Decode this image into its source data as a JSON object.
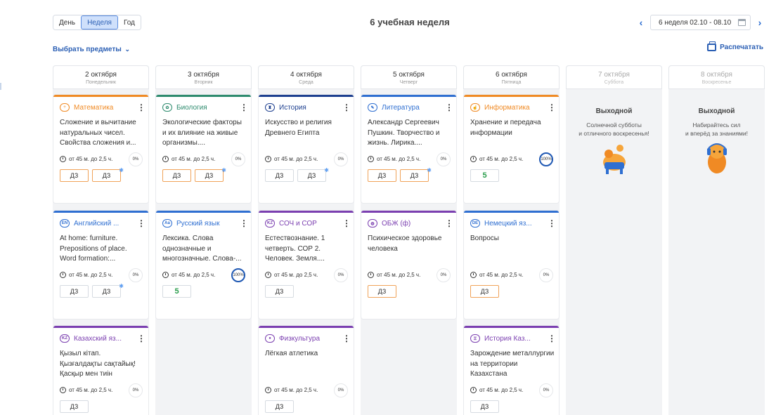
{
  "toolbar": {
    "views": [
      "День",
      "Неделя",
      "Год"
    ],
    "active_view": "Неделя",
    "title": "6 учебная неделя",
    "week_range": "6 неделя 02.10 - 08.10",
    "select_subjects": "Выбрать предметы",
    "print": "Распечатать"
  },
  "card_defaults": {
    "duration": "от 45 м. до 2,5 ч.",
    "hw_label": "ДЗ"
  },
  "days": [
    {
      "date": "2 октября",
      "weekday": "Понедельник",
      "lessons": [
        {
          "subject": "Математика",
          "color": "#f08a24",
          "icon": "math-icon",
          "topic": "Сложение и вычитание натуральных чисел. Свойства сложения и...",
          "progress": "0%",
          "hw": [
            {
              "orange": true,
              "dot": false
            },
            {
              "orange": true,
              "dot": true
            }
          ]
        },
        {
          "subject": "Английский ...",
          "color": "#2f6fd1",
          "icon": "eng-icon",
          "topic": "At home: furniture. Prepositions of place. Word formation:...",
          "progress": "0%",
          "hw": [
            {
              "orange": false,
              "dot": false
            },
            {
              "orange": false,
              "dot": true
            }
          ]
        },
        {
          "subject": "Казахский яз...",
          "color": "#7b3fb0",
          "icon": "kz-icon",
          "topic": "Қызыл кітап. Қызғалдақты сақтайық! Қасқыр мен тиін",
          "progress": "0%",
          "hw": [
            {
              "orange": false,
              "dot": false
            }
          ]
        }
      ]
    },
    {
      "date": "3 октября",
      "weekday": "Вторник",
      "lessons": [
        {
          "subject": "Биология",
          "color": "#2e8b6e",
          "icon": "biology-icon",
          "topic": "Экологические факторы и их влияние на живые организмы....",
          "progress": "0%",
          "hw": [
            {
              "orange": true,
              "dot": false
            },
            {
              "orange": true,
              "dot": true
            }
          ]
        },
        {
          "subject": "Русский язык",
          "color": "#2f6fd1",
          "icon": "russian-icon",
          "topic": "Лексика. Слова однозначные и многозначные. Слова-...",
          "progress": "100%",
          "grade": "5"
        }
      ]
    },
    {
      "date": "4 октября",
      "weekday": "Среда",
      "lessons": [
        {
          "subject": "История",
          "color": "#1d3f8f",
          "icon": "history-icon",
          "topic": "Искусство и религия Древнего Египта",
          "progress": "0%",
          "hw": [
            {
              "orange": false,
              "dot": false
            },
            {
              "orange": false,
              "dot": true
            }
          ]
        },
        {
          "subject": "СОЧ и СОР",
          "color": "#7b3fb0",
          "icon": "kz-icon",
          "topic": "Естествознание. 1 четверть. СОР 2. Человек. Земля....",
          "progress": "0%",
          "hw": [
            {
              "orange": false,
              "dot": false
            }
          ]
        },
        {
          "subject": "Физкультура",
          "color": "#7b3fb0",
          "icon": "ball-icon",
          "topic": "Лёгкая атлетика",
          "progress": "0%",
          "hw": [
            {
              "orange": false,
              "dot": false
            }
          ]
        }
      ]
    },
    {
      "date": "5 октября",
      "weekday": "Четверг",
      "lessons": [
        {
          "subject": "Литература",
          "color": "#2f6fd1",
          "icon": "literature-icon",
          "topic": "Александр Сергеевич Пушкин. Творчество и жизнь. Лирика....",
          "progress": "0%",
          "hw": [
            {
              "orange": true,
              "dot": false
            },
            {
              "orange": true,
              "dot": true
            }
          ]
        },
        {
          "subject": "ОБЖ (ф)",
          "color": "#7b3fb0",
          "icon": "safety-icon",
          "topic": "Психическое здоровье человека",
          "progress": "0%",
          "hw": [
            {
              "orange": true,
              "dot": false
            }
          ]
        }
      ]
    },
    {
      "date": "6 октября",
      "weekday": "Пятница",
      "lessons": [
        {
          "subject": "Информатика",
          "color": "#f08a24",
          "icon": "informatics-icon",
          "topic": "Хранение и передача информации",
          "progress": "100%",
          "grade": "5"
        },
        {
          "subject": "Немецкий яз...",
          "color": "#2f6fd1",
          "icon": "deu-icon",
          "topic": "Вопросы",
          "progress": "0%",
          "hw": [
            {
              "orange": true,
              "dot": false
            }
          ]
        },
        {
          "subject": "История Каз...",
          "color": "#7b3fb0",
          "icon": "history-kz-icon",
          "topic": "Зарождение металлургии на территории Казахстана",
          "progress": "0%",
          "hw": [
            {
              "orange": false,
              "dot": false
            }
          ]
        }
      ]
    },
    {
      "date": "7 октября",
      "weekday": "Суббота",
      "weekend": true,
      "off_title": "Выходной",
      "off_text": "Солнечной субботы\nи отличного воскресенья!",
      "off_image": "resting-character-illustration"
    },
    {
      "date": "8 октября",
      "weekday": "Воскресенье",
      "weekend": true,
      "off_title": "Выходной",
      "off_text": "Набирайтесь сил\nи вперёд за знаниями!",
      "off_image": "music-character-illustration"
    }
  ]
}
